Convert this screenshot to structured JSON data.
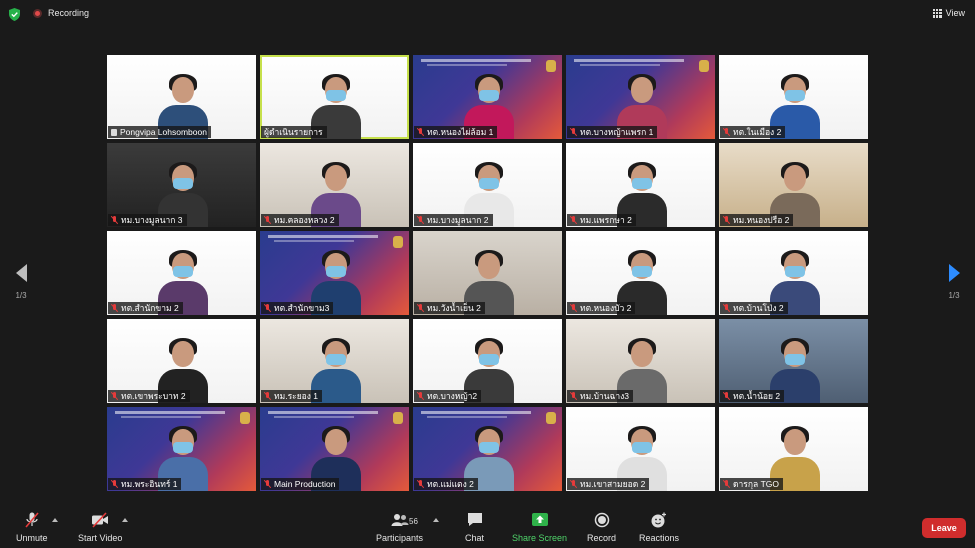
{
  "topbar": {
    "recording_label": "Recording",
    "view_label": "View"
  },
  "navigation": {
    "page_left": "1/3",
    "page_right": "1/3"
  },
  "tiles": [
    {
      "name": "Pongvipa Lohsomboon",
      "bg": "white",
      "icon": "pin",
      "active": false
    },
    {
      "name": "ผู้ดำเนินรายการ",
      "bg": "white",
      "icon": "none",
      "active": true
    },
    {
      "name": "ทต.หนองไผ่ล้อม 1",
      "bg": "slide",
      "icon": "mic-off",
      "active": false
    },
    {
      "name": "ทต.บางหญ้าแพรก 1",
      "bg": "slide",
      "icon": "mic-off",
      "active": false
    },
    {
      "name": "ทต.ในเมือง 2",
      "bg": "white",
      "icon": "mic-off",
      "active": false
    },
    {
      "name": "ทม.บางมูลนาก 3",
      "bg": "dark",
      "icon": "mic-off",
      "active": false
    },
    {
      "name": "ทม.คลองหลวง 2",
      "bg": "office",
      "icon": "mic-off",
      "active": false
    },
    {
      "name": "ทม.บางมูลนาก 2",
      "bg": "white",
      "icon": "mic-off",
      "active": false
    },
    {
      "name": "ทม.แพรกษา 2",
      "bg": "white",
      "icon": "mic-off",
      "active": false
    },
    {
      "name": "ทม.หนองปรือ 2",
      "bg": "hall",
      "icon": "mic-off",
      "active": false
    },
    {
      "name": "ทต.สำนักขาม 2",
      "bg": "white",
      "icon": "mic-off",
      "active": false
    },
    {
      "name": "ทต.สำนักขาม3",
      "bg": "slide",
      "icon": "mic-off",
      "active": false
    },
    {
      "name": "ทม.วังน้ำเย็น 2",
      "bg": "room",
      "icon": "mic-off",
      "active": false
    },
    {
      "name": "ทต.หนองบัว 2",
      "bg": "white",
      "icon": "mic-off",
      "active": false
    },
    {
      "name": "ทต.บ้านโป่ง 2",
      "bg": "white",
      "icon": "mic-off",
      "active": false
    },
    {
      "name": "ทต.เขาพระบาท 2",
      "bg": "white",
      "icon": "mic-off",
      "active": false
    },
    {
      "name": "ทม.ระยอง 1",
      "bg": "office",
      "icon": "mic-off",
      "active": false
    },
    {
      "name": "ทต.บางหญ้า2",
      "bg": "white",
      "icon": "mic-off",
      "active": false
    },
    {
      "name": "ทม.บ้านฉาง3",
      "bg": "office",
      "icon": "mic-off",
      "active": false
    },
    {
      "name": "ทต.น้ำน้อย 2",
      "bg": "bluewall",
      "icon": "mic-off",
      "active": false
    },
    {
      "name": "ทม.พระอินทร์ 1",
      "bg": "slide",
      "icon": "mic-off",
      "active": false
    },
    {
      "name": "Main Production",
      "bg": "slide",
      "icon": "mic-off",
      "active": false
    },
    {
      "name": "ทต.แม่แตง 2",
      "bg": "slide",
      "icon": "mic-off",
      "active": false
    },
    {
      "name": "ทม.เขาสามยอด 2",
      "bg": "white",
      "icon": "mic-off",
      "active": false
    },
    {
      "name": "ดารกุล TGO",
      "bg": "white",
      "icon": "mic-off",
      "active": false
    }
  ],
  "toolbar": {
    "unmute": "Unmute",
    "start_video": "Start Video",
    "participants": "Participants",
    "participant_count": "56",
    "chat": "Chat",
    "share_screen": "Share Screen",
    "record": "Record",
    "reactions": "Reactions",
    "leave": "Leave"
  },
  "colors": {
    "accent_green": "#2fb34a",
    "leave_red": "#d02d2d",
    "active_border": "#c6e04b",
    "nav_blue": "#2d8cff"
  }
}
